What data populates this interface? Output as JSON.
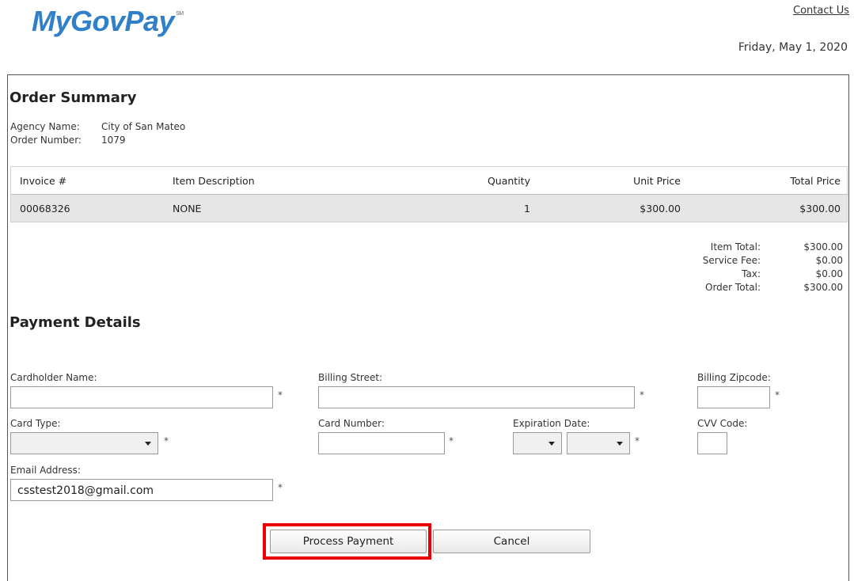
{
  "header": {
    "logo_text": "MyGovPay",
    "logo_mark": "SM",
    "contact_label": "Contact Us",
    "date": "Friday, May 1, 2020"
  },
  "order_summary": {
    "title": "Order Summary",
    "agency_label": "Agency Name:",
    "agency_value": "City of San Mateo",
    "order_label": "Order Number:",
    "order_value": "1079",
    "columns": [
      "Invoice #",
      "Item Description",
      "Quantity",
      "Unit Price",
      "Total Price"
    ],
    "rows": [
      {
        "invoice": "00068326",
        "description": "NONE",
        "quantity": "1",
        "unit_price": "$300.00",
        "total_price": "$300.00"
      }
    ],
    "totals": {
      "item_total_label": "Item Total:",
      "item_total": "$300.00",
      "service_fee_label": "Service Fee:",
      "service_fee": "$0.00",
      "tax_label": "Tax:",
      "tax": "$0.00",
      "order_total_label": "Order Total:",
      "order_total": "$300.00"
    }
  },
  "payment": {
    "title": "Payment Details",
    "cardholder_label": "Cardholder Name:",
    "street_label": "Billing Street:",
    "zip_label": "Billing Zipcode:",
    "card_type_label": "Card Type:",
    "card_number_label": "Card Number:",
    "expiration_label": "Expiration Date:",
    "cvv_label": "CVV Code:",
    "email_label": "Email Address:",
    "email_value": "csstest2018@gmail.com",
    "required_mark": "*"
  },
  "actions": {
    "process_label": "Process Payment",
    "cancel_label": "Cancel",
    "highlight_color": "#ee0000"
  }
}
